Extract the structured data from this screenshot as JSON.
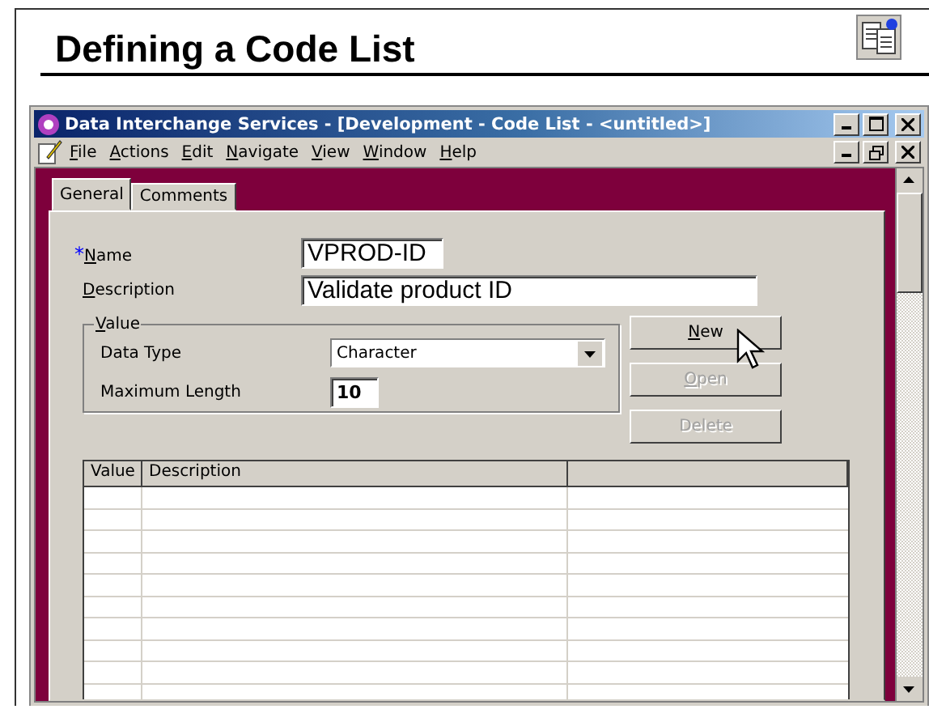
{
  "slide_title": "Defining a Code List",
  "window": {
    "title": "Data Interchange Services - [Development - Code List - <untitled>]"
  },
  "menu": [
    "File",
    "Actions",
    "Edit",
    "Navigate",
    "View",
    "Window",
    "Help"
  ],
  "tabs": [
    {
      "label": "General",
      "selected": true
    },
    {
      "label": "Comments",
      "selected": false
    }
  ],
  "form": {
    "name_label": "Name",
    "required_mark": "*",
    "name_value": "VPROD-ID",
    "description_label": "Description",
    "description_value": "Validate product ID"
  },
  "value_group": {
    "title": "Value",
    "data_type_label": "Data Type",
    "data_type_value": "Character",
    "max_length_label": "Maximum Length",
    "max_length_value": "10"
  },
  "buttons": [
    {
      "label": "New",
      "disabled": false
    },
    {
      "label": "Open",
      "disabled": true
    },
    {
      "label": "Delete",
      "disabled": true
    }
  ],
  "table": {
    "columns": [
      "Value",
      "Description"
    ]
  }
}
